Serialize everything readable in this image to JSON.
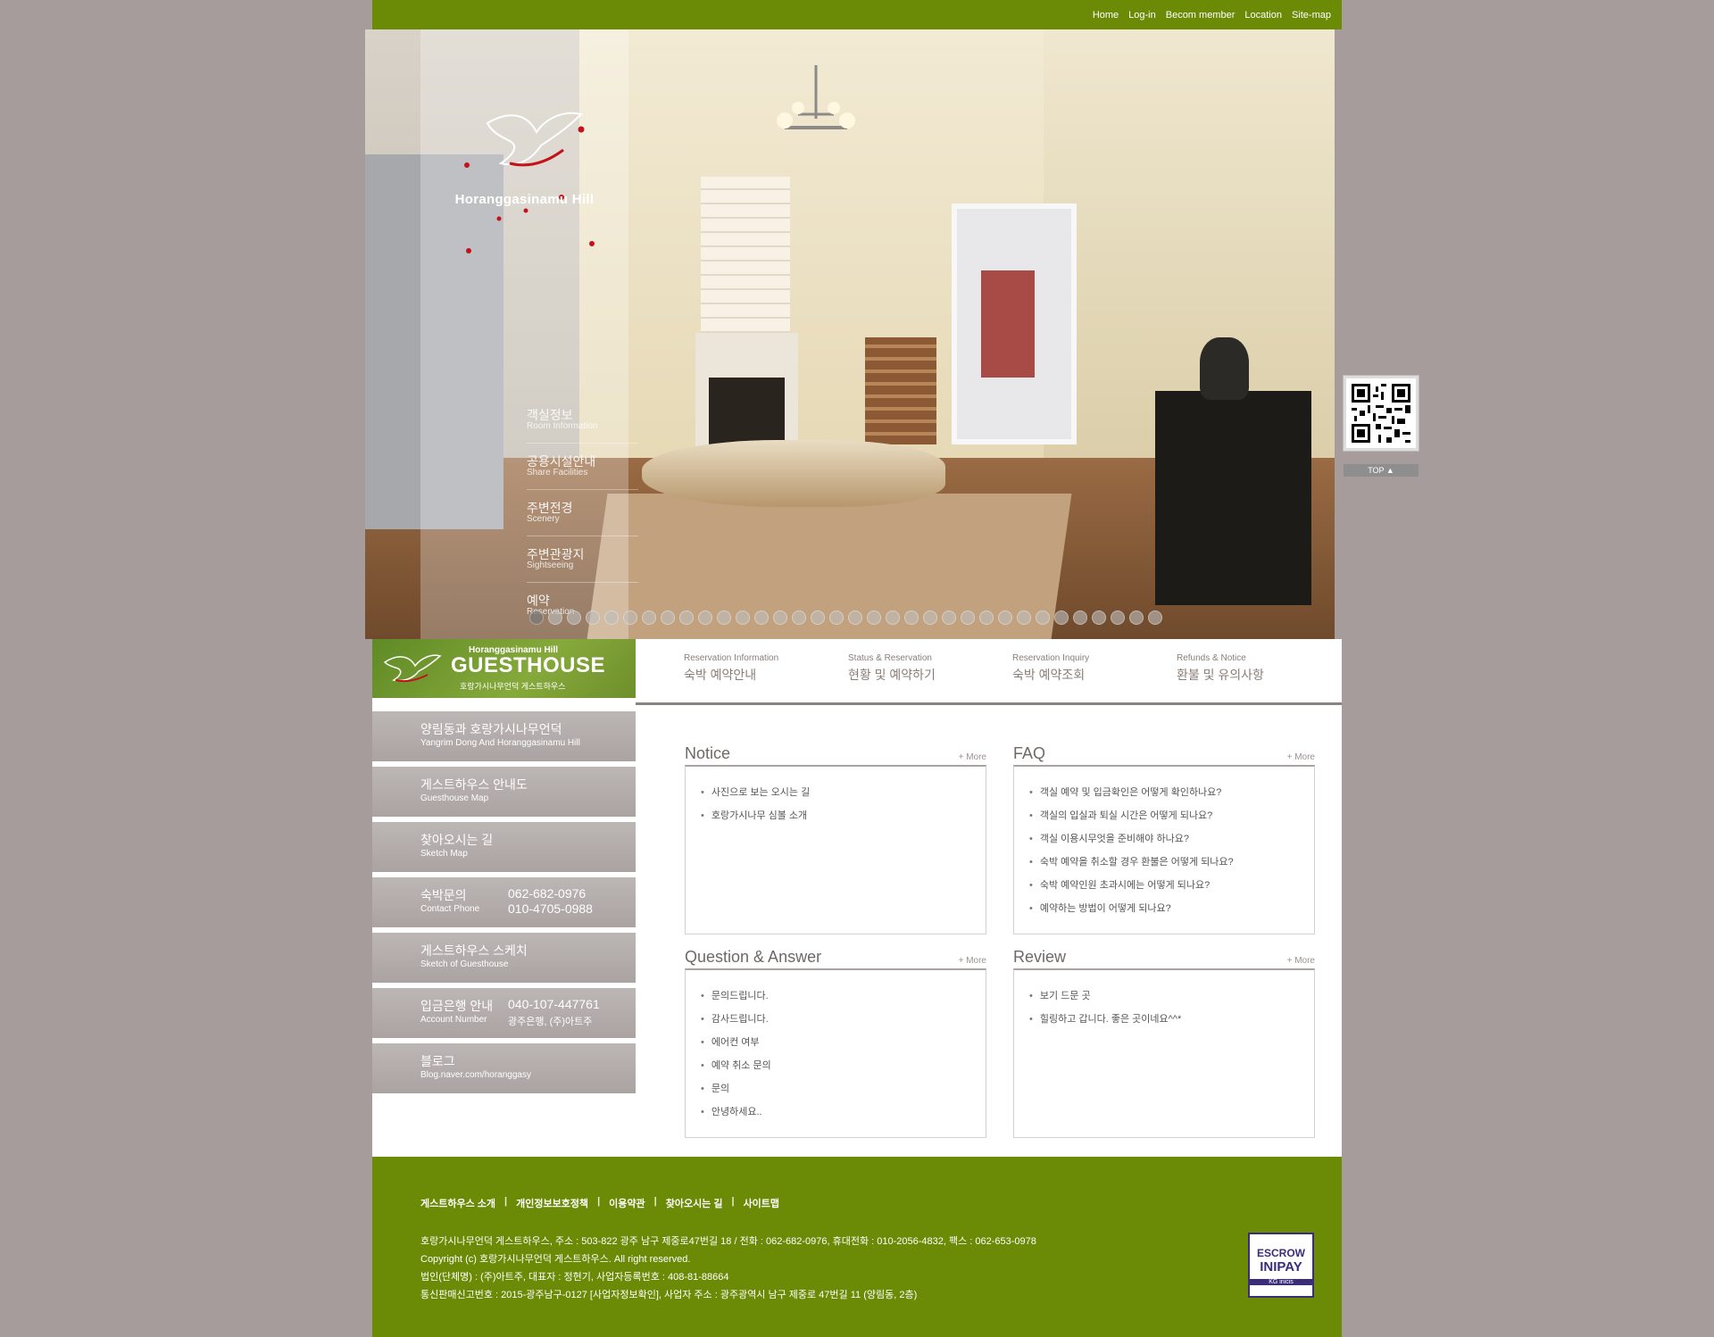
{
  "top_nav": [
    "Home",
    "Log-in",
    "Becom member",
    "Location",
    "Site-map"
  ],
  "brand": {
    "logo_name": "Horanggasinamu Hill"
  },
  "hero_menu": [
    {
      "ko": "객실정보",
      "en": "Room Information"
    },
    {
      "ko": "공용시설안내",
      "en": "Share Facilities"
    },
    {
      "ko": "주변전경",
      "en": "Scenery"
    },
    {
      "ko": "주변관광지",
      "en": "Sightseeing"
    },
    {
      "ko": "예약",
      "en": "Reservation"
    }
  ],
  "slider": {
    "dot_count": 34,
    "active_index": 0
  },
  "qr": {
    "top_label": "TOP ▲"
  },
  "guesthouse_banner": {
    "line1": "Horanggasinamu Hill",
    "line2": "GUESTHOUSE",
    "line3": "호랑가시나무언덕 게스트하우스"
  },
  "side_menu": {
    "items": [
      {
        "ko": "양림동과 호랑가시나무언덕",
        "en": "Yangrim Dong And Horanggasinamu Hill"
      },
      {
        "ko": "게스트하우스 안내도",
        "en": "Guesthouse Map"
      },
      {
        "ko": "찾아오시는 길",
        "en": "Sketch Map"
      },
      {
        "ko": "숙박문의",
        "en": "Contact Phone",
        "phone1": "062-682-0976",
        "phone2": "010-4705-0988"
      },
      {
        "ko": "게스트하우스 스케치",
        "en": "Sketch of Guesthouse"
      },
      {
        "ko": "입금은행 안내",
        "en": "Account Number",
        "account": "040-107-447761",
        "bank": "광주은행, (주)아트주"
      },
      {
        "ko": "블로그",
        "en": "Blog.naver.com/horanggasy"
      }
    ]
  },
  "quick_tabs": [
    {
      "en": "Reservation Information",
      "ko": "숙박 예약안내"
    },
    {
      "en": "Status & Reservation",
      "ko": "현황 및 예약하기"
    },
    {
      "en": "Reservation Inquiry",
      "ko": "숙박 예약조회"
    },
    {
      "en": "Refunds & Notice",
      "ko": "환불 및 유의사항"
    }
  ],
  "boards": {
    "more_label": "+ More",
    "notice": {
      "title": "Notice",
      "items": [
        "사진으로 보는 오시는 길",
        "호랑가시나무 심볼 소개"
      ]
    },
    "faq": {
      "title": "FAQ",
      "items": [
        "객실 예약 및 입금확인은 어떻게 확인하나요?",
        "객실의 입실과 퇴실 시간은 어떻게 되나요?",
        "객실 이용시무엇을 준비해야 하나요?",
        "숙박 예약을 취소할 경우 환불은 어떻게 되나요?",
        "숙박 예약인원 초과시에는 어떻게 되나요?",
        "예약하는 방법이 어떻게 되나요?"
      ]
    },
    "qna": {
      "title": "Question & Answer",
      "items": [
        "문의드립니다.",
        "감사드립니다.",
        "에어컨 여부",
        "예약 취소 문의",
        "문의",
        "안녕하세요.."
      ]
    },
    "review": {
      "title": "Review",
      "items": [
        "보기 드문 곳",
        "힐링하고 갑니다. 좋은 곳이네요^^*"
      ]
    }
  },
  "footer": {
    "links": [
      "게스트하우스 소개",
      "개인정보보호정책",
      "이용약관",
      "찾아오시는 길",
      "사이트맵"
    ],
    "info": [
      "호랑가시나무언덕 게스트하우스, 주소 : 503-822 광주 남구 제중로47번길 18 / 전화 : 062-682-0976, 휴대전화 : 010-2056-4832, 팩스 : 062-653-0978",
      "Copyright (c) 호랑가시나무언덕 게스트하우스. All right reserved.",
      "법인(단체명) : (주)아트주, 대표자 : 정현기, 사업자등록번호 : 408-81-88664",
      "통신판매신고번호 : 2015-광주남구-0127 [사업자정보확인], 사업자 주소 : 광주광역시 남구 제중로 47번길 11 (양림동, 2층)"
    ],
    "escrow": {
      "line1": "ESCROW",
      "line2": "INIPAY",
      "line3": "KG inicis"
    }
  },
  "colors": {
    "brand_green": "#6b8a06",
    "page_bg": "#a59c9b",
    "side_menu_bg": "#bcb6b4",
    "accent_text": "#8a7d78"
  }
}
